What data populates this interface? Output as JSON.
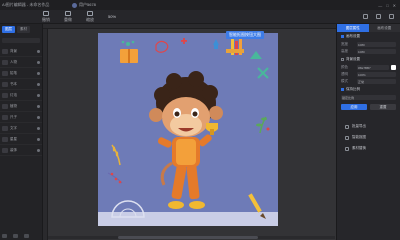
{
  "titlebar": {
    "title": "AI图片编辑器 - 未命名作品",
    "user_name": "用户5678",
    "window_controls": [
      "minimize-icon",
      "maximize-icon",
      "close-icon"
    ]
  },
  "toolbar": {
    "buttons": [
      {
        "label": "撤销",
        "icon": "undo-icon"
      },
      {
        "label": "重做",
        "icon": "redo-icon"
      },
      {
        "label": "缩放",
        "icon": "zoom-icon"
      }
    ],
    "zoom_value": "50%",
    "right_icons": [
      "grid-icon",
      "layers-icon",
      "export-icon"
    ]
  },
  "left_panel": {
    "tabs": [
      "图层",
      "素材"
    ],
    "active_tab": 0,
    "layers": [
      "背景",
      "人物",
      "铅笔",
      "书本",
      "灯泡",
      "植物",
      "尺子",
      "文字",
      "星星",
      "装饰"
    ]
  },
  "canvas": {
    "floating_label": "智能抠图按钮大图",
    "artboard_bg": "#6e7bb7",
    "floor_color": "#c9cde6"
  },
  "right_panel": {
    "tabs": [
      "图层属性",
      "画布设置"
    ],
    "active_tab": 0,
    "section1": "画布设置",
    "section2": "背景设置",
    "rows": [
      {
        "label": "宽度",
        "value": "1080"
      },
      {
        "label": "高度",
        "value": "1080"
      }
    ],
    "bg_rows": [
      {
        "label": "颜色",
        "value": "#6E7BB7"
      },
      {
        "label": "透明",
        "value": "100%"
      },
      {
        "label": "模式",
        "value": "正常"
      }
    ],
    "checkbox_label": "保持比例",
    "checkbox_value": "锁定比例",
    "apply_label": "应用",
    "reset_label": "重置",
    "menu": [
      "批量导出",
      "智能抠图",
      "素材替换"
    ]
  },
  "colors": {
    "accent": "#2f6fe4",
    "panel_bg": "#26262a",
    "canvas_bg": "#333336"
  }
}
